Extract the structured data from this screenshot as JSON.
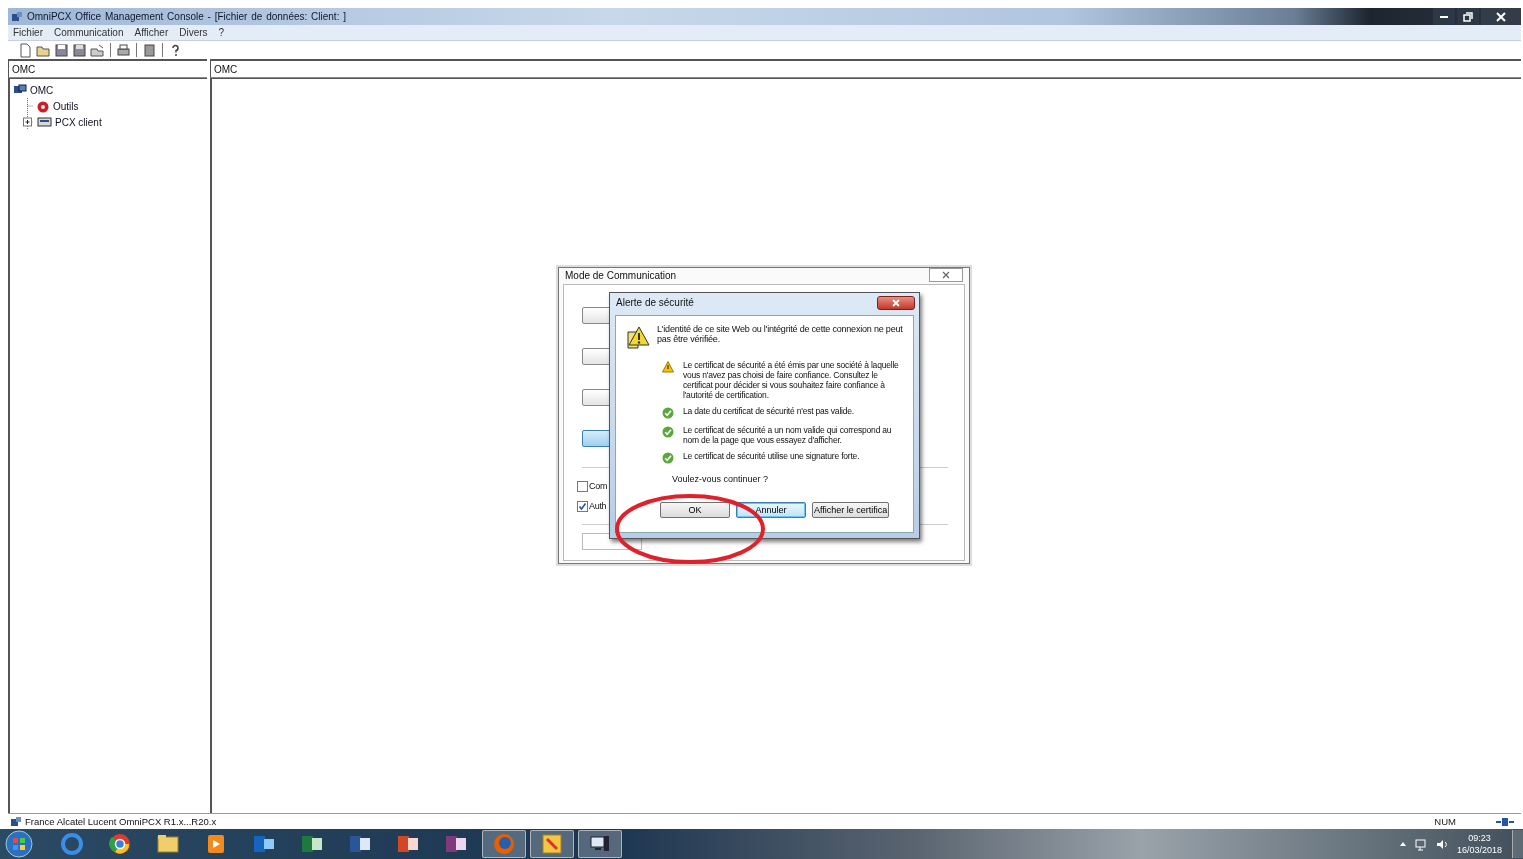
{
  "window": {
    "title": "OmniPCX Office Management Console - [Fichier de données:      Client: ]"
  },
  "menu": [
    {
      "label": "Fichier"
    },
    {
      "label": "Communication"
    },
    {
      "label": "Afficher"
    },
    {
      "label": "Divers"
    },
    {
      "label": "?"
    }
  ],
  "left_panel": {
    "header": "OMC",
    "tree": [
      {
        "label": "OMC",
        "kind": "root",
        "children": [
          {
            "label": "Outils",
            "kind": "tools"
          },
          {
            "label": "PCX client",
            "kind": "client",
            "expanded": false
          }
        ]
      }
    ]
  },
  "right_panel": {
    "header": "OMC"
  },
  "communication_dialog": {
    "title": "Mode de Communication",
    "options": [
      {
        "selected": false
      },
      {
        "selected": false
      },
      {
        "selected": false
      },
      {
        "selected": true
      }
    ],
    "checkboxes": [
      {
        "label": "Com",
        "checked": false
      },
      {
        "label": "Auth",
        "checked": true
      }
    ]
  },
  "security_alert": {
    "title": "Alerte de sécurité",
    "message": "L'identité de ce site Web ou l'intégrité de cette connexion ne peut pas être vérifiée.",
    "items": [
      {
        "kind": "warning",
        "text": "Le certificat de sécurité a été émis par une société à laquelle vous n'avez pas choisi de faire confiance. Consultez le certificat pour décider si vous souhaitez faire confiance à l'autorité de certification."
      },
      {
        "kind": "ok",
        "text": "La date du certificat de sécurité n'est pas valide."
      },
      {
        "kind": "ok",
        "text": "Le certificat de sécurité a un nom valide qui correspond au nom de la page que vous essayez d'afficher."
      },
      {
        "kind": "ok",
        "text": "Le certificat de sécurité utilise une signature forte."
      }
    ],
    "question": "Voulez-vous continuer ?",
    "buttons": [
      {
        "label": "OK",
        "selected": false
      },
      {
        "label": "Annuler",
        "selected": true
      },
      {
        "label": "Afficher le certifica",
        "selected": false
      }
    ]
  },
  "status_bar": {
    "text": "France Alcatel Lucent OmniPCX R1.x...R20.x",
    "indicator": "NUM"
  },
  "taskbar": {
    "time": "09:23",
    "date": "16/03/2018"
  }
}
